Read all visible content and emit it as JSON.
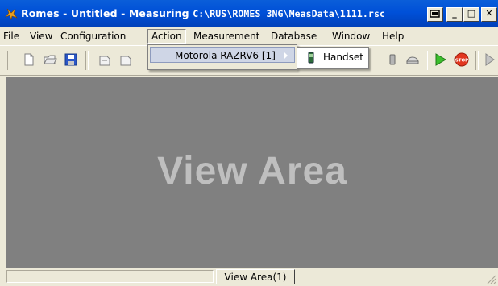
{
  "window": {
    "app_name": "Romes",
    "title_middle": " - Untitled - Measuring ",
    "title_path": "C:\\RUS\\ROMES 3NG\\MeasData\\1111.rsc",
    "app_icon": "romes-app-icon",
    "controls": [
      "restore-icon",
      "minimize-icon",
      "maximize-icon",
      "close-icon"
    ],
    "minimize_glyph": "_",
    "maximize_glyph": "□",
    "close_glyph": "✕"
  },
  "menubar": {
    "items": [
      "File",
      "View",
      "Configuration",
      "Action",
      "Measurement",
      "Database",
      "Window",
      "Help"
    ],
    "active": "Action"
  },
  "toolbar": {
    "icons": [
      "new-icon",
      "open-icon",
      "save-icon",
      "undo-icon",
      "redo-icon",
      "phone-config-icon",
      "device-icon",
      "play-icon",
      "stop-icon",
      "next-icon"
    ],
    "stop_label": "STOP"
  },
  "action_menu": {
    "item": "Motorola RAZRV6 [1]",
    "submenu": {
      "item": "Handset",
      "icon": "phone-icon"
    }
  },
  "view": {
    "title": "View Area"
  },
  "tabs": {
    "active": "View Area(1)"
  },
  "colors": {
    "titlebar": "#0054e3",
    "view_background": "#808080",
    "view_text": "#bfbfbf",
    "menu_highlight": "#cfd6e6"
  }
}
